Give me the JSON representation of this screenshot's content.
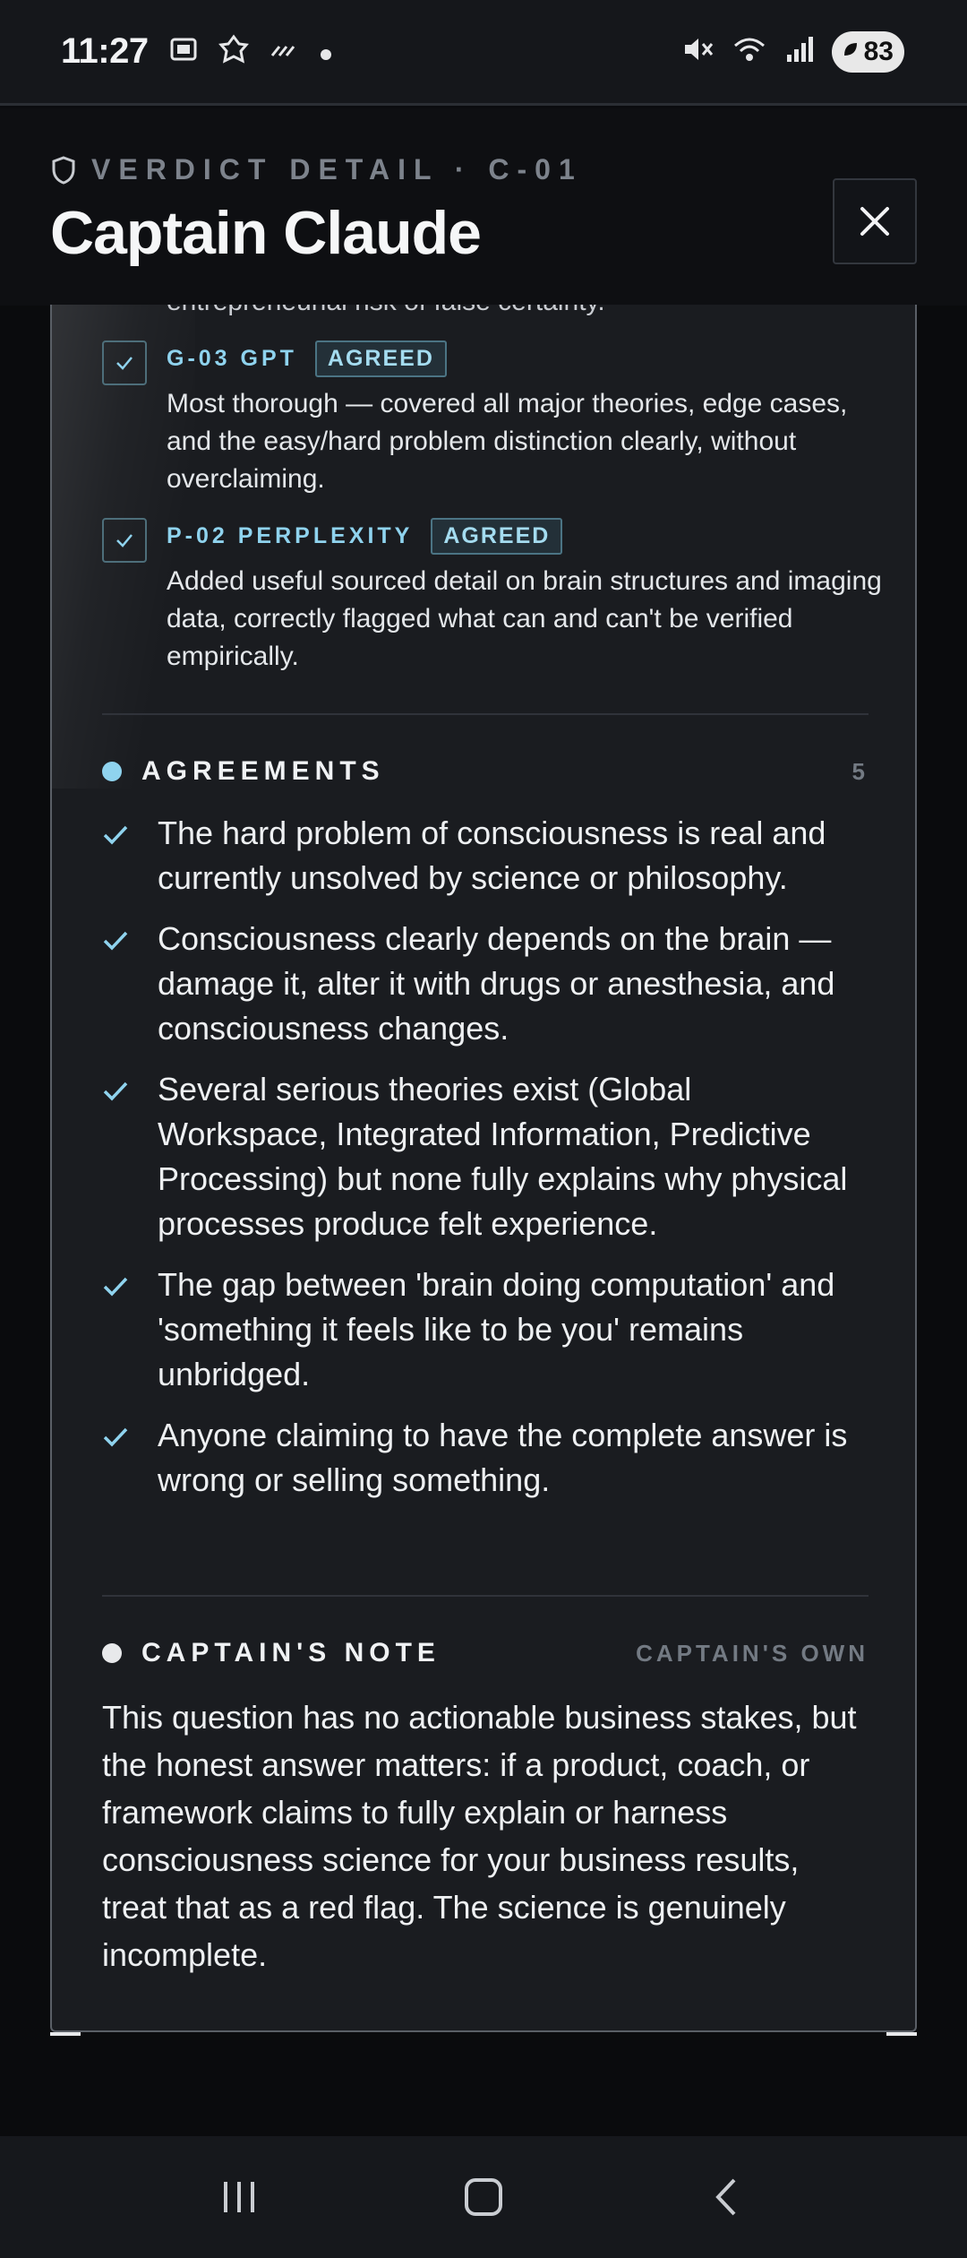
{
  "status_bar": {
    "time": "11:27",
    "left_icons": [
      "gallery-icon",
      "app-icon",
      "stripes-icon",
      "dot-icon"
    ],
    "right_icons": [
      "mute-icon",
      "wifi-icon",
      "signal-icon"
    ],
    "battery": "83"
  },
  "header": {
    "eyebrow": "VERDICT DETAIL · C-01",
    "title": "Captain Claude"
  },
  "critiques": {
    "cut_text": "entrepreneurial risk of false certainty.",
    "items": [
      {
        "name": "G-03 GPT",
        "badge": "AGREED",
        "text": "Most thorough — covered all major theories, edge cases, and the easy/hard problem distinction clearly, without overclaiming."
      },
      {
        "name": "P-02 PERPLEXITY",
        "badge": "AGREED",
        "text": "Added useful sourced detail on brain structures and imaging data, correctly flagged what can and can't be verified empirically."
      }
    ]
  },
  "agreements": {
    "title": "AGREEMENTS",
    "count": "5",
    "items": [
      "The hard problem of consciousness is real and currently unsolved by science or philosophy.",
      "Consciousness clearly depends on the brain — damage it, alter it with drugs or anesthesia, and consciousness changes.",
      "Several serious theories exist (Global Workspace, Integrated Information, Predictive Processing) but none fully explains why physical processes produce felt experience.",
      "The gap between 'brain doing computation' and 'something it feels like to be you' remains unbridged.",
      "Anyone claiming to have the complete answer is wrong or selling something."
    ]
  },
  "captains_note": {
    "title": "CAPTAIN'S NOTE",
    "meta": "CAPTAIN'S OWN",
    "text": "This question has no actionable business stakes, but the honest answer matters: if a product, coach, or framework claims to fully explain or harness consciousness science for your business results, treat that as a red flag. The science is genuinely incomplete."
  },
  "colors": {
    "accent": "#8fd3ee",
    "note_dot": "#e8e9eb"
  }
}
